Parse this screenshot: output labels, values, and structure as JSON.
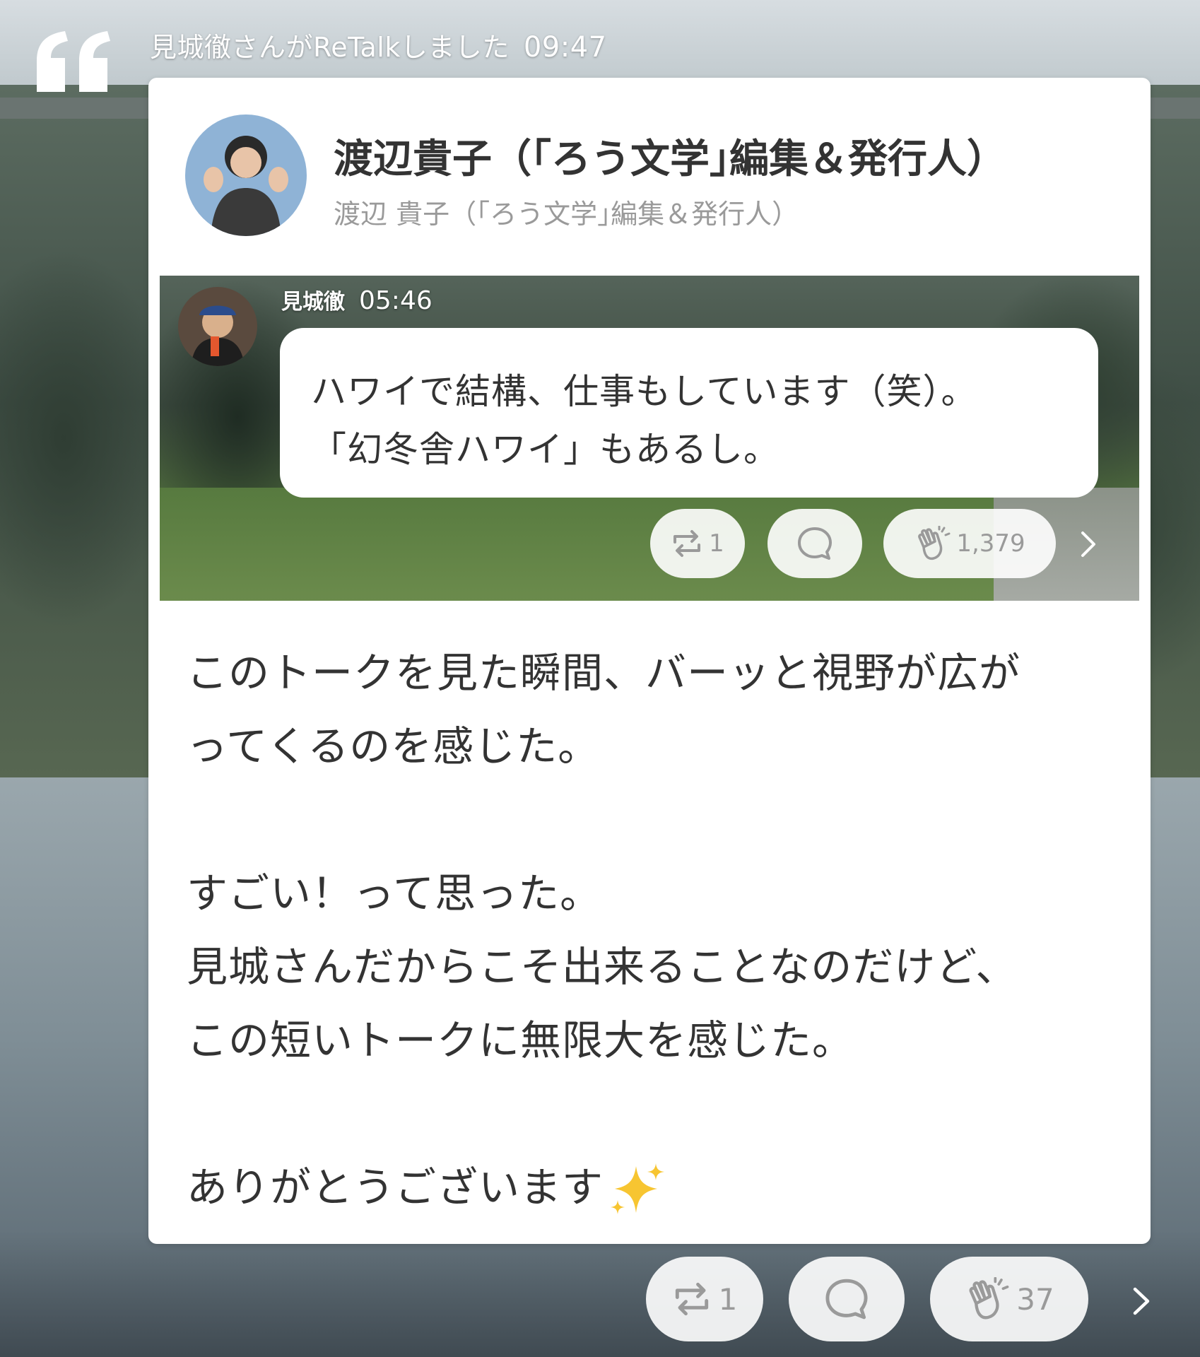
{
  "header": {
    "retalk_text": "見城徹さんがReTalkしました",
    "time": "09:47"
  },
  "post": {
    "author_name": "渡辺貴子（｢ろう文学｣編集＆発行人）",
    "author_subname": "渡辺 貴子（｢ろう文学｣編集＆発行人）",
    "body_lines": [
      "このトークを見た瞬間、バーッと視野が広が",
      "ってくるのを感じた。",
      "",
      "すごい！って思った。",
      "見城さんだからこそ出来ることなのだけど、",
      "この短いトークに無限大を感じた。",
      "",
      "ありがとうございます"
    ],
    "sparkle_emoji": "sparkles-icon"
  },
  "quoted_talk": {
    "author": "見城徹",
    "time": "05:46",
    "lines": [
      "ハワイで結構、仕事もしています（笑）。",
      "「幻冬舎ハワイ」もあるし。"
    ],
    "actions": {
      "retalk_count": "1",
      "clap_count": "1,379"
    }
  },
  "actions": {
    "retalk_count": "1",
    "clap_count": "37"
  },
  "icons": [
    "quote-icon",
    "retalk-icon",
    "comment-icon",
    "clap-icon",
    "chevron-right-icon",
    "sparkles-icon"
  ],
  "colors": {
    "card_bg": "#ffffff",
    "text": "#333333",
    "subtext": "#9a9a9a",
    "pill_bg": "#ffffff"
  }
}
